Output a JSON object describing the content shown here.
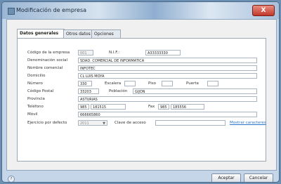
{
  "window": {
    "title": "Modificación de empresa",
    "close_label": "X"
  },
  "tabs": [
    {
      "label": "Datos generales"
    },
    {
      "label": "Otros datos"
    },
    {
      "label": "Opciones"
    }
  ],
  "form": {
    "codigo_label": "Código de la empresa",
    "codigo_value": "001",
    "nif_label": "N.I.F.:",
    "nif_value": "A33333330",
    "denominacion_label": "Denominación social",
    "denominacion_value": "SDAD. COMERCIAL DE INFORMATICA",
    "nombre_label": "Nombre comercial",
    "nombre_value": "INFOTEC",
    "domicilio_label": "Domicilio",
    "domicilio_value": "CL LUIS MOYA",
    "numero_label": "Número",
    "numero_value": "330",
    "escalera_label": "Escalera",
    "escalera_value": "",
    "piso_label": "Piso",
    "piso_value": "",
    "puerta_label": "Puerta",
    "puerta_value": "",
    "cp_label": "Código Postal",
    "cp_value": "33203",
    "poblacion_label": "Población",
    "poblacion_value": "GIJON",
    "provincia_label": "Provincia",
    "provincia_value": "ASTURIAS",
    "telefono_label": "Teléfono",
    "telefono_prefix": "985",
    "telefono_value": "181515",
    "fax_label": "Fax",
    "fax_prefix": "985",
    "fax_value": "185556",
    "movil_label": "Móvil",
    "movil_value": "666665860",
    "ejercicio_label": "Ejercicio por defecto",
    "ejercicio_value": "2011",
    "clave_label": "Clave de acceso",
    "clave_value": "",
    "mostrar_link": "Mostrar caracteres"
  },
  "footer": {
    "help_label": "?",
    "accept_label": "Aceptar",
    "cancel_label": "Cancelar"
  }
}
